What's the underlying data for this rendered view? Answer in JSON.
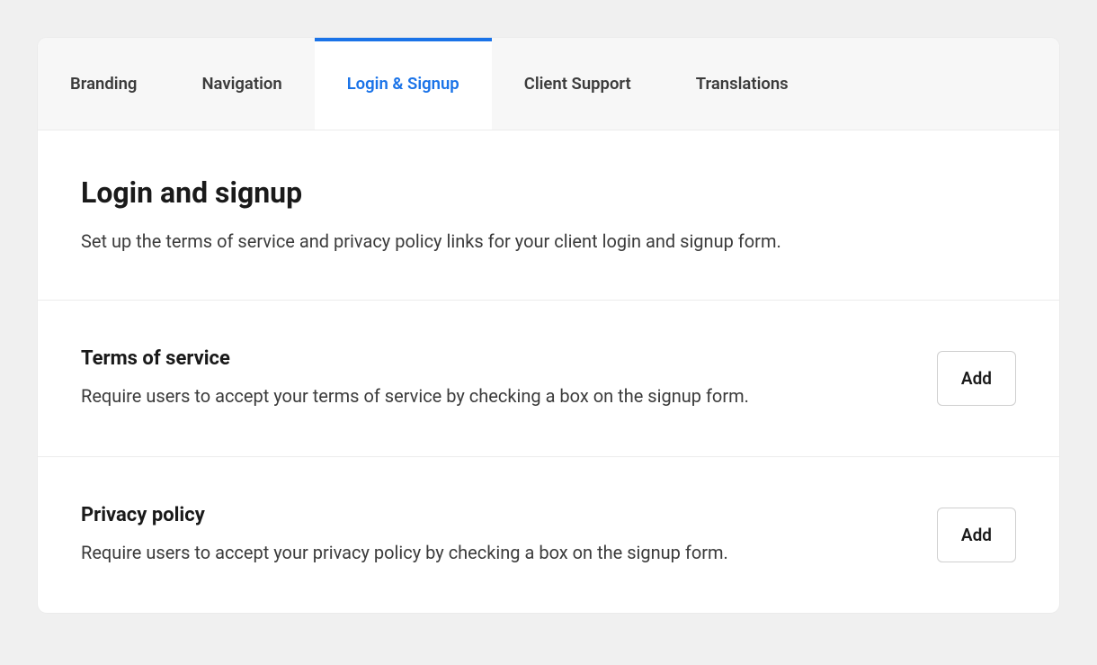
{
  "tabs": [
    {
      "label": "Branding",
      "active": false
    },
    {
      "label": "Navigation",
      "active": false
    },
    {
      "label": "Login & Signup",
      "active": true
    },
    {
      "label": "Client Support",
      "active": false
    },
    {
      "label": "Translations",
      "active": false
    }
  ],
  "header": {
    "title": "Login and signup",
    "description": "Set up the terms of service and privacy policy links for your client login and signup form."
  },
  "rows": [
    {
      "title": "Terms of service",
      "description": "Require users to accept your terms of service by checking a box on the signup form.",
      "button": "Add"
    },
    {
      "title": "Privacy policy",
      "description": "Require users to accept your privacy policy by checking a box on the signup form.",
      "button": "Add"
    }
  ]
}
